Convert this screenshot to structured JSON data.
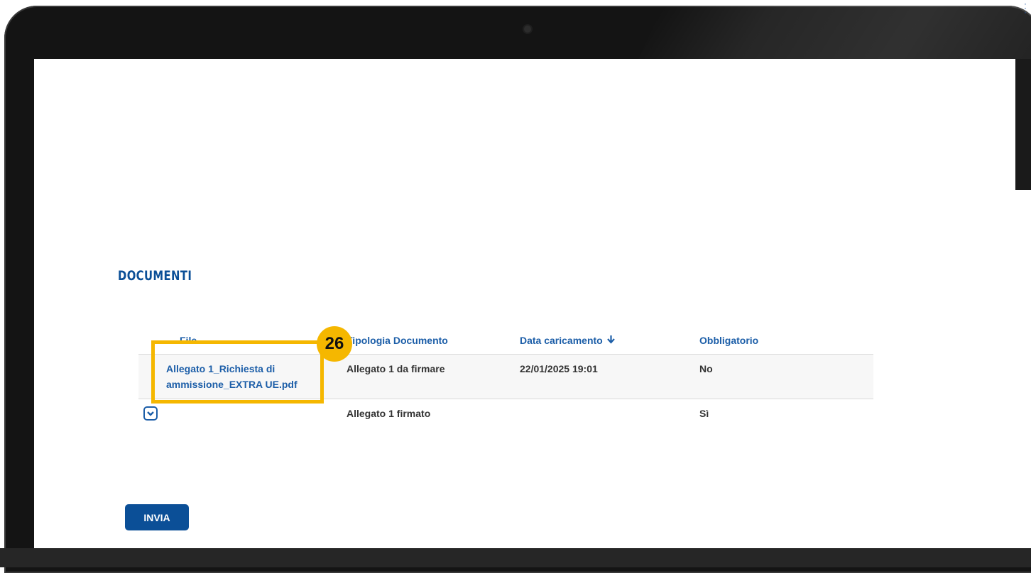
{
  "section": {
    "title": "DOCUMENTI"
  },
  "table": {
    "headers": {
      "file": "File",
      "tipologia": "Tipologia Documento",
      "data": "Data caricamento",
      "obbligatorio": "Obbligatorio"
    },
    "sort_icon": "arrow-down-icon",
    "rows": [
      {
        "file": "Allegato 1_Richiesta di ammissione_EXTRA UE.pdf",
        "tipologia": "Allegato 1 da firmare",
        "data": "22/01/2025 19:01",
        "obbligatorio": "No"
      },
      {
        "file": "",
        "tipologia": "Allegato 1 firmato",
        "data": "",
        "obbligatorio": "Sì"
      }
    ]
  },
  "annotation": {
    "step_number": "26",
    "color": "#f5b700"
  },
  "actions": {
    "send_label": "INVIA"
  },
  "colors": {
    "primary": "#0b4f97",
    "link": "#1c5ea8"
  }
}
